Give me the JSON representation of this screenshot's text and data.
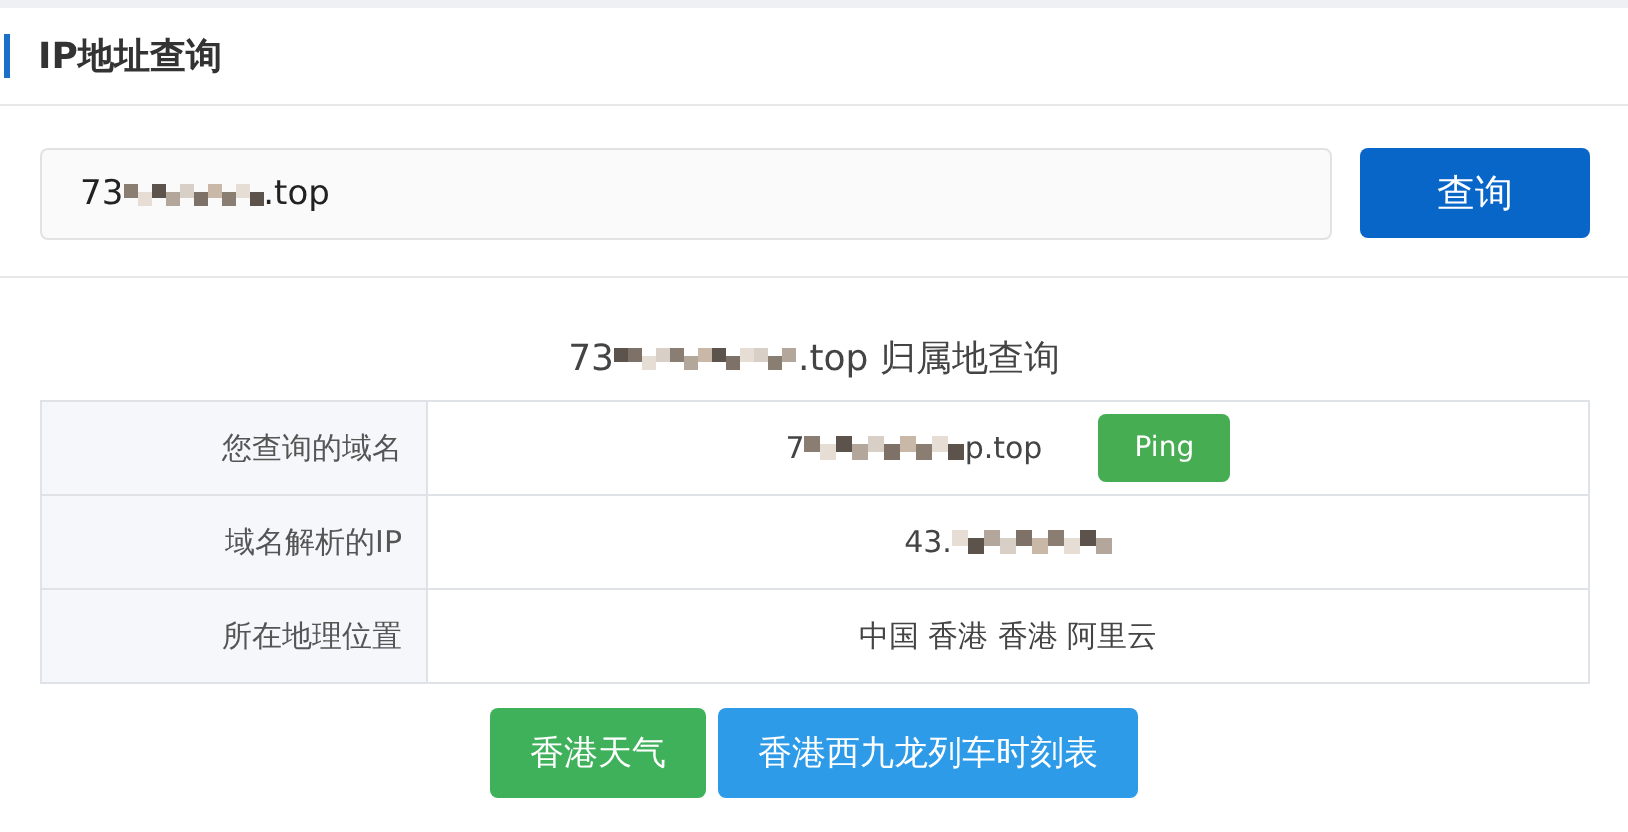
{
  "header": {
    "title": "IP地址查询"
  },
  "search": {
    "value_start": "73",
    "masked": true,
    "value_end": ".top",
    "button": "查询"
  },
  "result": {
    "title_start": "73",
    "masked": true,
    "title_end": ".top 归属地查询",
    "rows": [
      {
        "label": "您查询的域名",
        "value_start": "7",
        "masked": true,
        "value_end": "p.top",
        "button": "Ping"
      },
      {
        "label": "域名解析的IP",
        "value_start": "43.",
        "masked": true
      },
      {
        "label": "所在地理位置",
        "value_start": "中国 香港 香港 阿里云",
        "masked": false
      }
    ]
  },
  "buttons": [
    {
      "label": "香港天气",
      "color": "#3fb15b"
    },
    {
      "label": "香港西九龙列车时刻表",
      "color": "#2e9be8"
    }
  ]
}
